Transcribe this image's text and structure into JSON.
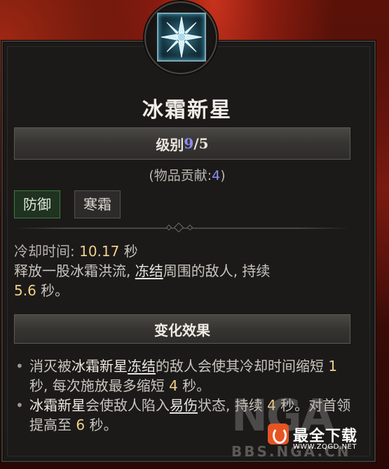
{
  "skill": {
    "title": "冰霜新星",
    "rank_label": "级别",
    "rank_current": "9",
    "rank_sep": "/",
    "rank_max": "5",
    "contrib_prefix": "(物品贡献:",
    "contrib_value": "4",
    "contrib_suffix": ")",
    "tags": [
      "防御",
      "寒霜"
    ],
    "icon": "frost-nova-snowflake-icon"
  },
  "description": {
    "cooldown_label": "冷却时间: ",
    "cooldown_value": "10.17",
    "cooldown_unit": " 秒",
    "text_1": "释放一股冰霜洪流, ",
    "freeze_keyword": "冻结",
    "text_2": "周围的敌人, 持续",
    "duration_value": "5.6",
    "duration_unit": " 秒。"
  },
  "modifiers": {
    "header": "变化效果",
    "item_1": {
      "bullet": "•",
      "pre": "消灭被",
      "skill_name": "冰霜新星",
      "freeze": "冻结",
      "mid": "的敌人会使其冷却时间缩短 ",
      "value_1": "1",
      "mid2": " 秒, 每次施放最多缩短 ",
      "value_2": "4",
      "end": " 秒。"
    },
    "item_2": {
      "bullet": "•",
      "skill_name": "冰霜新星",
      "mid": "会使敌人陷入",
      "vulnerable": "易伤",
      "mid2": "状态, 持续 ",
      "value_1": "4",
      "mid3": " 秒。对首领提高至 ",
      "value_2": "6",
      "end": " 秒。"
    }
  },
  "watermark": {
    "big": "NGA",
    "site_cn": "最全下载",
    "site_url": "WWW.ZQGD.NET",
    "sub": "BBS.NGA.CN"
  },
  "colors": {
    "accent_blue": "#8f8cf5",
    "value_gold": "#f0cf8a",
    "tag_green": "#3e7a3c"
  }
}
